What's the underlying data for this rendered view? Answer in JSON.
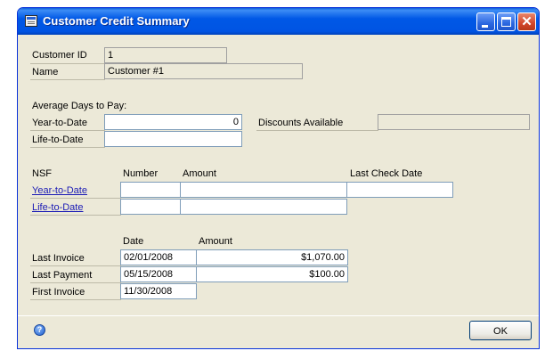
{
  "window": {
    "title": "Customer Credit Summary"
  },
  "customer": {
    "id_label": "Customer ID",
    "id_value": "1",
    "name_label": "Name",
    "name_value": "Customer #1"
  },
  "avg_days": {
    "section_label": "Average Days to Pay:",
    "ytd_label": "Year-to-Date",
    "ytd_value": "0",
    "ltd_label": "Life-to-Date",
    "ltd_value": "",
    "discounts_label": "Discounts Available",
    "discounts_value": ""
  },
  "nsf": {
    "label": "NSF",
    "columns": {
      "number": "Number",
      "amount": "Amount",
      "last_check_date": "Last Check Date"
    },
    "rows": [
      {
        "label": "Year-to-Date",
        "number": "",
        "amount": "",
        "last_check_date": ""
      },
      {
        "label": "Life-to-Date",
        "number": "",
        "amount": ""
      }
    ]
  },
  "activity": {
    "columns": {
      "date": "Date",
      "amount": "Amount"
    },
    "rows": [
      {
        "label": "Last Invoice",
        "date": "02/01/2008",
        "amount": "$1,070.00"
      },
      {
        "label": "Last Payment",
        "date": "05/15/2008",
        "amount": "$100.00"
      },
      {
        "label": "First Invoice",
        "date": "11/30/2008"
      }
    ]
  },
  "footer": {
    "ok_label": "OK",
    "help_icon": "help-icon"
  }
}
